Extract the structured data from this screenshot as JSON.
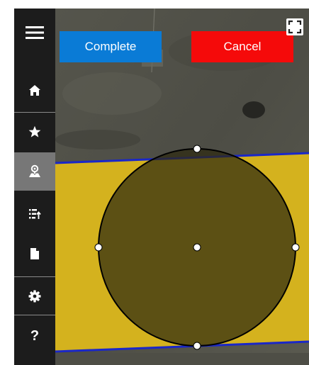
{
  "toolbar": {
    "complete_label": "Complete",
    "cancel_label": "Cancel"
  },
  "sidebar": {
    "items": [
      {
        "icon": "hamburger-menu-icon"
      },
      {
        "icon": "home-icon"
      },
      {
        "icon": "star-icon"
      },
      {
        "icon": "map-pin-icon",
        "active": true
      },
      {
        "icon": "sort-list-icon"
      },
      {
        "icon": "document-icon"
      },
      {
        "icon": "gear-icon"
      },
      {
        "icon": "help-icon",
        "label": "?"
      }
    ]
  },
  "map": {
    "controls": {
      "fullscreen": "fullscreen-icon"
    }
  },
  "colors": {
    "sidebar": "#1c1c1c",
    "sidebar_active": "#777777",
    "complete": "#0a7bd6",
    "cancel": "#f50a0a",
    "field": "#d4b21e",
    "boundary": "#1a27c8",
    "circle_fill": "#2e2a10"
  }
}
